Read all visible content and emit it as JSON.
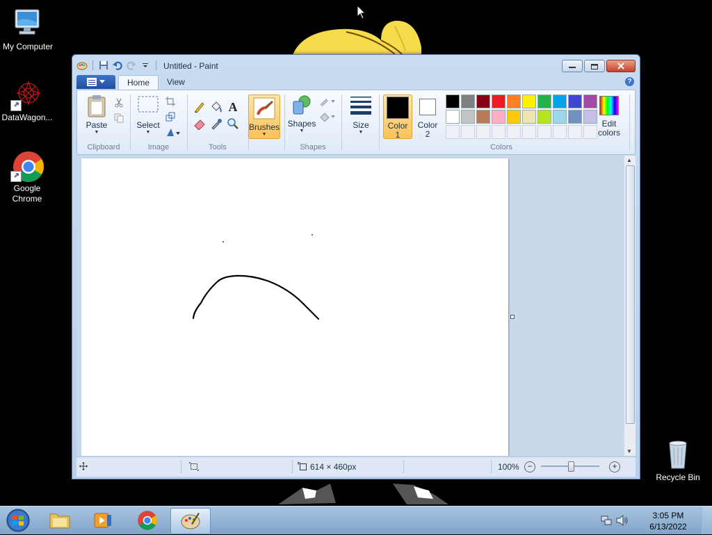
{
  "desktop": {
    "icons": [
      {
        "label": "My Computer"
      },
      {
        "label": "DataWagon..."
      },
      {
        "label": "Google Chrome"
      },
      {
        "label": "Recycle Bin"
      }
    ]
  },
  "window": {
    "title": "Untitled - Paint",
    "tabs": {
      "home": "Home",
      "view": "View"
    },
    "help": "?"
  },
  "ribbon": {
    "clipboard": {
      "paste": "Paste",
      "group": "Clipboard"
    },
    "image": {
      "select": "Select",
      "group": "Image"
    },
    "tools": {
      "group": "Tools",
      "text_glyph": "A"
    },
    "brushes": {
      "label": "Brushes"
    },
    "shapes": {
      "label": "Shapes",
      "group": "Shapes"
    },
    "size": {
      "label": "Size"
    },
    "colors": {
      "color1": "Color\n1",
      "color1_line1": "Color",
      "color1_line2": "1",
      "color2_line1": "Color",
      "color2_line2": "2",
      "edit_line1": "Edit",
      "edit_line2": "colors",
      "group": "Colors",
      "selected_color1": "#000000",
      "selected_color2": "#ffffff",
      "palette_row1": [
        "#000000",
        "#7f7f7f",
        "#880015",
        "#ed1c24",
        "#ff7f27",
        "#fff200",
        "#22b14c",
        "#00a2e8",
        "#3f48cc",
        "#a349a4"
      ],
      "palette_row2": [
        "#ffffff",
        "#c3c3c3",
        "#b97a57",
        "#ffaec9",
        "#ffc90e",
        "#efe4b0",
        "#b5e61d",
        "#99d9ea",
        "#7092be",
        "#c8bfe7"
      ]
    }
  },
  "status": {
    "canvas_size": "614 × 460px",
    "zoom": "100%"
  },
  "taskbar": {
    "clock_time": "3:05 PM",
    "clock_date": "6/13/2022"
  }
}
